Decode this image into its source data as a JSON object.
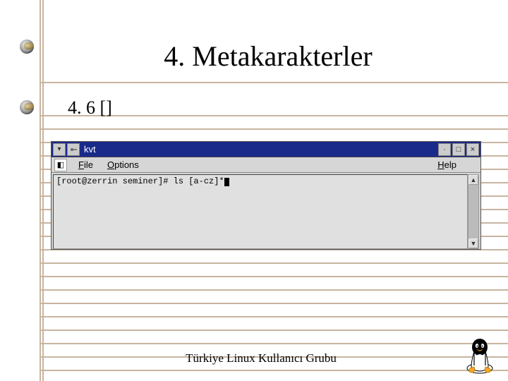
{
  "title": "4. Metakarakterler",
  "subhead": "4. 6 []",
  "footer": "Türkiye Linux Kullanıcı Grubu",
  "window": {
    "title": "kvt",
    "menu": {
      "file": "File",
      "options": "Options",
      "help": "Help"
    },
    "terminal": {
      "line1": "[root@zerrin seminer]# ls [a-cz]*"
    },
    "buttons": {
      "iconify": "·",
      "maximize": "□",
      "close": "×"
    }
  },
  "ruled_tops": [
    116,
    163,
    182,
    201,
    220,
    239,
    258,
    277,
    296,
    315,
    334,
    353,
    372,
    391,
    410,
    429,
    448,
    467,
    486,
    505,
    524
  ]
}
